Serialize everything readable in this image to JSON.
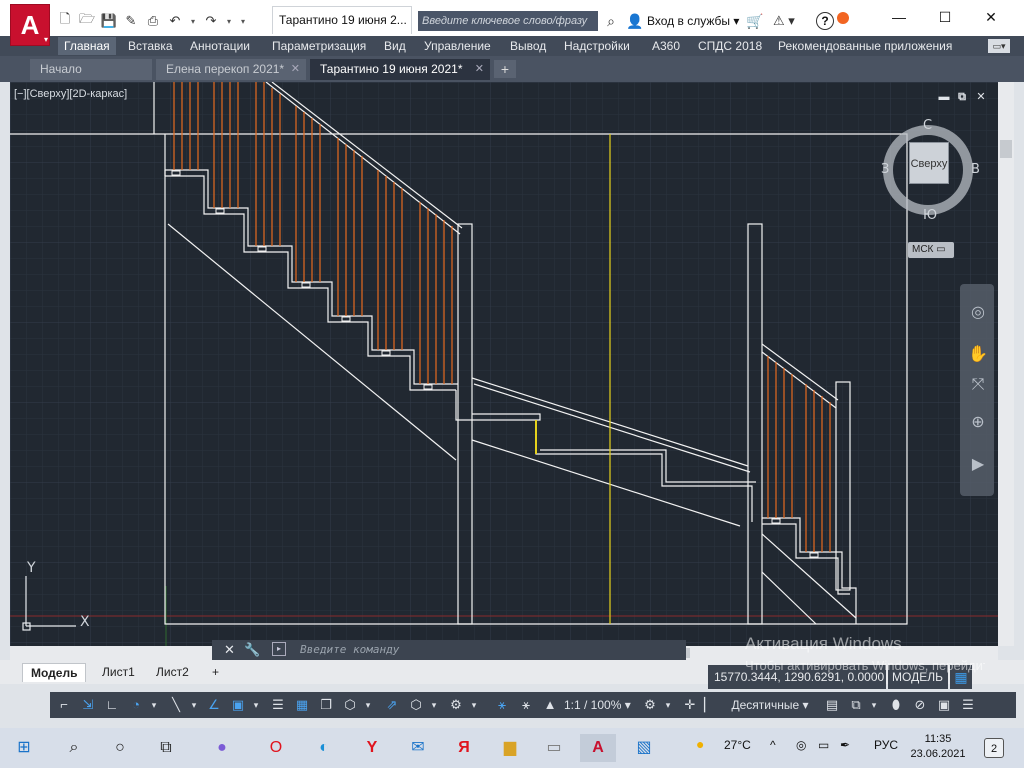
{
  "titlebar": {
    "doc_title": "Тарантино 19 июня 2...",
    "search_placeholder": "Введите ключевое слово/фразу",
    "login_label": "Вход в службы",
    "logo_letter": "A",
    "minimize": "—",
    "maximize": "☐",
    "close": "✕"
  },
  "ribbon": {
    "tabs": [
      "Главная",
      "Вставка",
      "Аннотации",
      "Параметризация",
      "Вид",
      "Управление",
      "Вывод",
      "Надстройки",
      "A360",
      "СПДС 2018",
      "Рекомендованные приложения"
    ],
    "active": "Главная"
  },
  "filetabs": {
    "tabs": [
      {
        "label": "Начало",
        "closable": false
      },
      {
        "label": "Елена перекоп 2021*",
        "closable": true
      },
      {
        "label": "Тарантино 19 июня 2021*",
        "closable": true,
        "active": true
      }
    ],
    "add": "+"
  },
  "viewport": {
    "label": "[−][Сверху][2D-каркас]",
    "viewcube": {
      "north": "С",
      "south": "Ю",
      "east": "В",
      "west": "З",
      "face": "Сверху"
    },
    "ucs": "МСК ▭",
    "axis_x": "X",
    "axis_y": "Y"
  },
  "command": {
    "placeholder": "Введите команду",
    "close": "✕",
    "customize": "🔧"
  },
  "layouts": {
    "tabs": [
      "Модель",
      "Лист1",
      "Лист2"
    ],
    "active": "Модель",
    "add": "+"
  },
  "status": {
    "coordinates": "15770.3444, 1290.6291, 0.0000",
    "mode": "МОДЕЛЬ",
    "annotation_scale": "1:1 / 100%",
    "units": "Десятичные"
  },
  "watermark": {
    "line1": "Активация Windows",
    "line2": "Чтобы активировать Windows, перейдите в раздел \"Параметры\"."
  },
  "taskbar": {
    "temperature": "27°C",
    "language": "РУС",
    "time": "11:35",
    "date": "23.06.2021",
    "notifications": "2"
  }
}
